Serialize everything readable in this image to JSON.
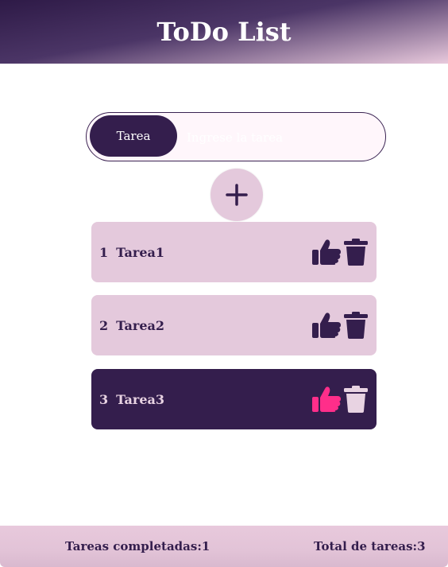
{
  "header": {
    "title": "ToDo List"
  },
  "form": {
    "label": "Tarea",
    "input_value": "",
    "input_placeholder": "Ingrese la tarea"
  },
  "add_button": {
    "icon": "plus-icon"
  },
  "tasks": [
    {
      "number": "1",
      "text": "Tarea1",
      "completed": false
    },
    {
      "number": "2",
      "text": "Tarea2",
      "completed": false
    },
    {
      "number": "3",
      "text": "Tarea3",
      "completed": true
    }
  ],
  "footer": {
    "completed": "Tareas completadas:1",
    "total": "Total de tareas:3"
  },
  "colors": {
    "primary": "#341e4d",
    "light": "#e4c9dc",
    "accent": "#ff2e8a"
  }
}
